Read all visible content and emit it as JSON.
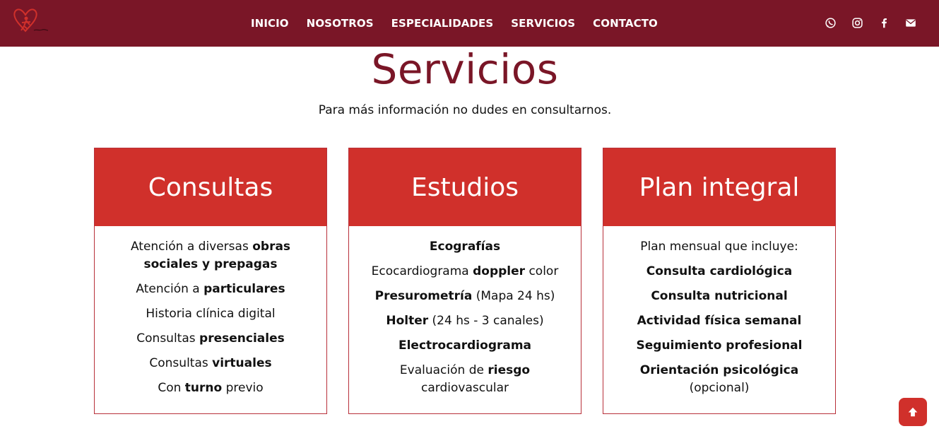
{
  "nav": {
    "items": [
      {
        "label": "INICIO"
      },
      {
        "label": "NOSOTROS"
      },
      {
        "label": "ESPECIALIDADES"
      },
      {
        "label": "SERVICIOS"
      },
      {
        "label": "CONTACTO"
      }
    ],
    "social_icons": [
      "whatsapp-icon",
      "instagram-icon",
      "facebook-icon",
      "envelope-icon"
    ]
  },
  "header": {
    "title": "Servicios",
    "subtitle": "Para más información no dudes en consultarnos."
  },
  "cards": [
    {
      "title": "Consultas",
      "items": [
        {
          "pre": "Atención a diversas ",
          "bold": "obras sociales y prepagas",
          "post": ""
        },
        {
          "pre": "Atención a ",
          "bold": "particulares",
          "post": ""
        },
        {
          "pre": "Historia clínica digital",
          "bold": "",
          "post": ""
        },
        {
          "pre": "Consultas ",
          "bold": "presenciales",
          "post": ""
        },
        {
          "pre": "Consultas ",
          "bold": "virtuales",
          "post": ""
        },
        {
          "pre": "Con ",
          "bold": "turno",
          "post": " previo"
        }
      ]
    },
    {
      "title": "Estudios",
      "items": [
        {
          "pre": "",
          "bold": "Ecografías",
          "post": ""
        },
        {
          "pre": "Ecocardiograma ",
          "bold": "doppler",
          "post": " color"
        },
        {
          "pre": "",
          "bold": "Presurometría",
          "post": " (Mapa 24 hs)"
        },
        {
          "pre": "",
          "bold": "Holter",
          "post": " (24 hs - 3 canales)"
        },
        {
          "pre": "",
          "bold": "Electrocardiograma",
          "post": ""
        },
        {
          "pre": "Evaluación de ",
          "bold": "riesgo",
          "post": " cardiovascular"
        }
      ]
    },
    {
      "title": "Plan integral",
      "items": [
        {
          "pre": "Plan mensual que incluye:",
          "bold": "",
          "post": ""
        },
        {
          "pre": "",
          "bold": "Consulta cardiológica",
          "post": ""
        },
        {
          "pre": "",
          "bold": "Consulta nutricional",
          "post": ""
        },
        {
          "pre": "",
          "bold": "Actividad física semanal",
          "post": ""
        },
        {
          "pre": "",
          "bold": "Seguimiento profesional",
          "post": ""
        },
        {
          "pre": "",
          "bold": "Orientación psicológica",
          "post": " (opcional)"
        }
      ]
    }
  ],
  "colors": {
    "navbar": "#7a1627",
    "accent": "#d0302b",
    "title": "#7a1627"
  }
}
